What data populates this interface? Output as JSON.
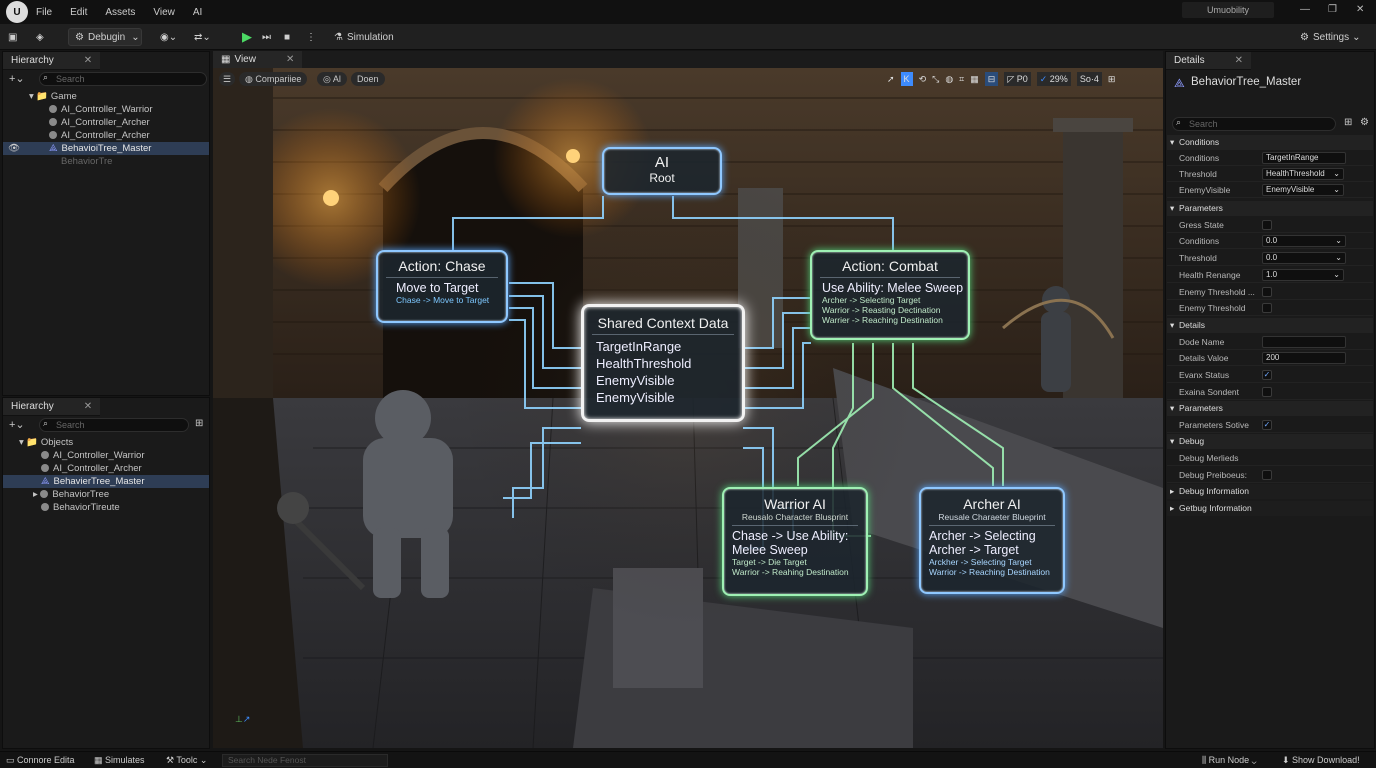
{
  "menubar": {
    "items": [
      "File",
      "Edit",
      "Assets",
      "View",
      "AI"
    ],
    "title": "Umuobility"
  },
  "toolbar": {
    "mode": "Debugin",
    "simulation": "Simulation",
    "settings": "Settings"
  },
  "hierarchy_top": {
    "tab": "Hierarchy",
    "search_placeholder": "Search",
    "root": "Game",
    "items": [
      "AI_Controller_Warrior",
      "AI_Controller_Archer",
      "AI_Controller_Archer",
      "BehavioiTree_Master",
      "BehaviorTre"
    ]
  },
  "hierarchy_bottom": {
    "tab": "Hierarchy",
    "search_placeholder": "Search",
    "root": "Objects",
    "items": [
      "AI_Controller_Warrior",
      "AI_Controller_Archer",
      "BehavierTree_Master",
      "BehaviorTree",
      "BehaviorTireute"
    ]
  },
  "view": {
    "tab": "View",
    "chips": [
      "Compariiee",
      "Al",
      "Doen"
    ],
    "zoom": "29%",
    "snap": "So·4",
    "po": "P0"
  },
  "graph": {
    "root": {
      "title": "AI",
      "subtitle": "Root"
    },
    "chase": {
      "title": "Action: Chase",
      "body": "Move to Target",
      "detail": "Chase -> Move to Target"
    },
    "combat": {
      "title": "Action: Combat",
      "body": "Use Ability: Melee Sweep",
      "details": [
        "Archer -> Selecting Target",
        "Warrior -> Reasting Dectination",
        "Warrier -> Reaching Destination"
      ]
    },
    "shared": {
      "title": "Shared Context Data",
      "items": [
        "TargetInRange",
        "HealthThreshold",
        "EnemyVisible",
        "EnemyVisible"
      ]
    },
    "warrior": {
      "title": "Warrior AI",
      "subtitle": "Reusalo Character Blusprint",
      "body": [
        "Chase -> Use Ability:",
        "Melee Sweep"
      ],
      "details": [
        "Target -> Die Target",
        "Warrior -> Reahing Destination"
      ]
    },
    "archer": {
      "title": "Archer AI",
      "subtitle": "Reusale Charaeter Blueprint",
      "body": [
        "Archer -> Selecting",
        "Archer -> Target"
      ],
      "details": [
        "Arckher -> Selecting Target",
        "Warrior -> Reaching Destination"
      ]
    }
  },
  "details": {
    "tab": "Details",
    "object": "BehaviorTree_Master",
    "search_placeholder": "Search",
    "sections": {
      "conditions": "Conditions",
      "parameters": "Parameters",
      "details": "Details",
      "parameters2": "Parameters",
      "debug": "Debug",
      "debug_info": "Debug Information",
      "getbug_info": "Getbug Information"
    },
    "rows": {
      "conditions": {
        "label": "Conditions",
        "value": "TargetInRange"
      },
      "threshold": {
        "label": "Threshold",
        "value": "HealthThreshold"
      },
      "enemy_visible": {
        "label": "EnemyVisible",
        "value": "EnemyVisible"
      },
      "gress_state": {
        "label": "Gress State"
      },
      "p_conditions": {
        "label": "Conditions",
        "value": "0.0"
      },
      "p_threshold": {
        "label": "Threshold",
        "value": "0.0"
      },
      "health_renange": {
        "label": "Health Renange",
        "value": "1.0"
      },
      "enemy_threshold1": {
        "label": "Enemy Threshold ..."
      },
      "enemy_threshold2": {
        "label": "Enemy Threshold"
      },
      "dode_name": {
        "label": "Dode Name",
        "value": ""
      },
      "details_value": {
        "label": "Details Valoe",
        "value": "200"
      },
      "evanx_status": {
        "label": "Evanx Status"
      },
      "exaina_sondent": {
        "label": "Exaina Sondent"
      },
      "parameters_sotive": {
        "label": "Parameters Sotive"
      },
      "debug_merlieds": {
        "label": "Debug Merlieds"
      },
      "debug_preiboeus": {
        "label": "Debug Preiboeus:"
      }
    }
  },
  "statusbar": {
    "console": "Connore Edita",
    "simulates": "Simulates",
    "tools": "Toolc",
    "search_placeholder": "Search Nede Fenost",
    "run_node": "Run Node",
    "downloads": "Show Download!"
  },
  "colors": {
    "accent": "#3d8bfd",
    "selection": "#2e3d55",
    "node_blue": "#8fc8ff",
    "node_green": "#9ff0b4"
  }
}
